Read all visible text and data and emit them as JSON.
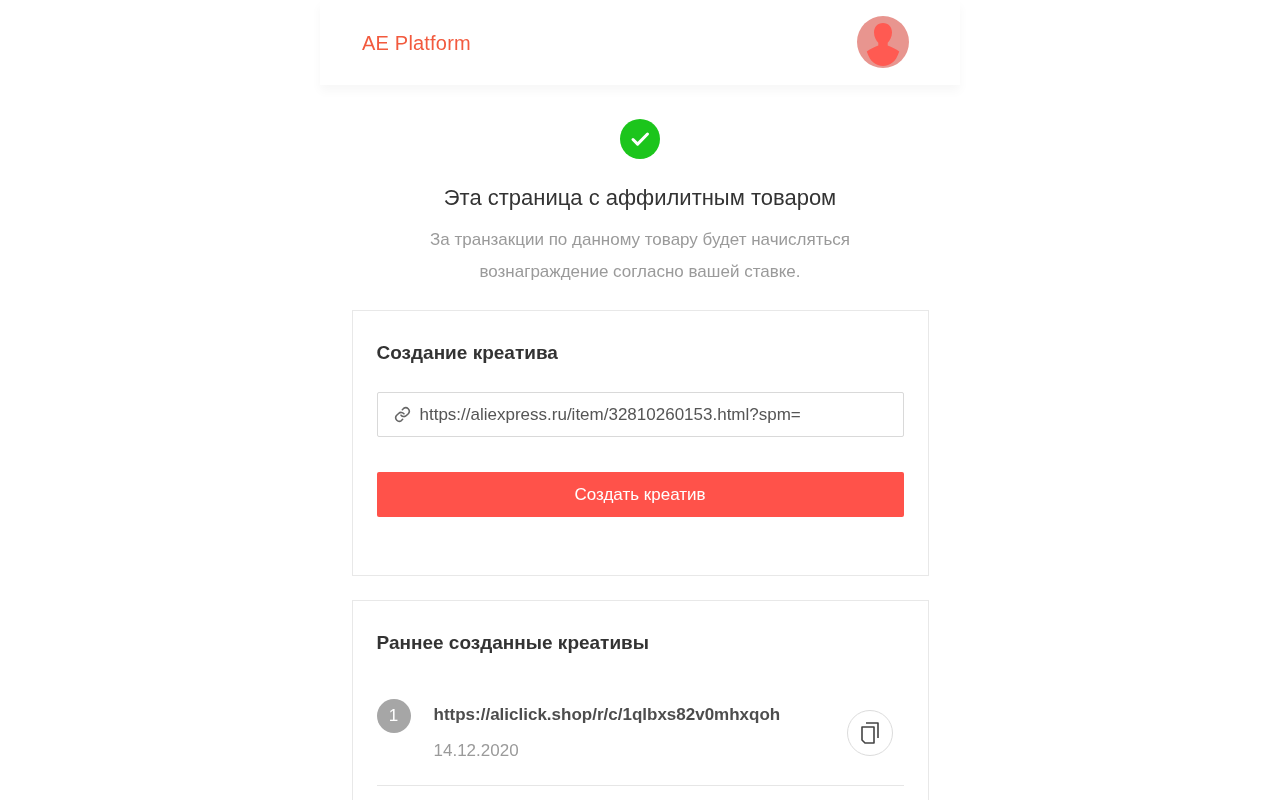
{
  "header": {
    "logo": "AE Platform"
  },
  "status": {
    "kind": "success",
    "title": "Эта страница с аффилитным товаром",
    "description": "За транзакции по данному товару будет начисляться вознаграждение согласно вашей ставке."
  },
  "create_card": {
    "title": "Создание креатива",
    "link_field": {
      "value": "https://aliexpress.ru/item/32810260153.html?spm="
    },
    "button": "Создать креатив"
  },
  "history_card": {
    "title": "Раннее созданные креативы",
    "items": [
      {
        "number": "1",
        "url": "https://aliclick.shop/r/c/1qlbxs82v0mhxqoh",
        "date": "14.12.2020"
      }
    ]
  }
}
